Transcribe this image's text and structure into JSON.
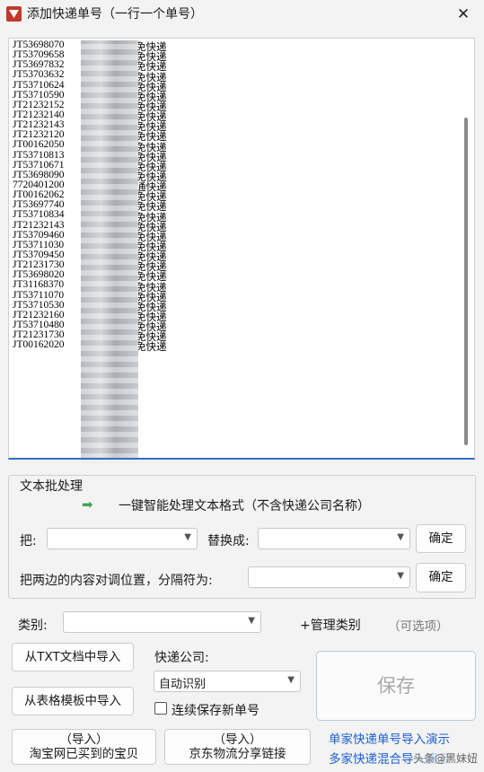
{
  "window": {
    "title": "添加快递单号（一行一个单号）",
    "close_symbol": "✕"
  },
  "textarea": {
    "lines": [
      {
        "id": "JT53698070",
        "svc": "免快递"
      },
      {
        "id": "JT53709658",
        "svc": "免快递"
      },
      {
        "id": "JT53697832",
        "svc": "免快递"
      },
      {
        "id": "JT53703632",
        "svc": "免快递"
      },
      {
        "id": "JT53710624",
        "svc": "免快递"
      },
      {
        "id": "JT53710590",
        "svc": "免快递"
      },
      {
        "id": "JT21232152",
        "svc": "免快递"
      },
      {
        "id": "JT21232140",
        "svc": "免快递"
      },
      {
        "id": "JT21232143",
        "svc": "免快递"
      },
      {
        "id": "JT21232120",
        "svc": "免快递"
      },
      {
        "id": "JT00162050",
        "svc": "免快递"
      },
      {
        "id": "JT53710813",
        "svc": "免快递"
      },
      {
        "id": "JT53710671",
        "svc": "免快递"
      },
      {
        "id": "JT53698090",
        "svc": "免快递"
      },
      {
        "id": "7720401200",
        "svc": "通快递"
      },
      {
        "id": "JT00162062",
        "svc": "免快递"
      },
      {
        "id": "JT53697740",
        "svc": "免快递"
      },
      {
        "id": "JT53710834",
        "svc": "免快递"
      },
      {
        "id": "JT21232143",
        "svc": "免快递"
      },
      {
        "id": "JT53709460",
        "svc": "免快递"
      },
      {
        "id": "JT53711030",
        "svc": "免快递"
      },
      {
        "id": "JT53709450",
        "svc": "免快递"
      },
      {
        "id": "JT21231730",
        "svc": "免快递"
      },
      {
        "id": "JT53698020",
        "svc": "免快递"
      },
      {
        "id": "JT31168370",
        "svc": "免快递"
      },
      {
        "id": "JT53711070",
        "svc": "免快递"
      },
      {
        "id": "JT53710530",
        "svc": "免快递"
      },
      {
        "id": "JT21232160",
        "svc": "免快递"
      },
      {
        "id": "JT53710480",
        "svc": "免快递"
      },
      {
        "id": "JT21231730",
        "svc": "免快递"
      },
      {
        "id": "JT00162020",
        "svc": "免快递"
      }
    ]
  },
  "batch": {
    "group_label": "文本批处理",
    "smart_process": "一键智能处理文本格式（不含快递公司名称）",
    "replace_label": "把:",
    "replace_with_label": "替换成:",
    "replace_from": "",
    "replace_to": "",
    "confirm_label": "确定",
    "swap_label": "把两边的内容对调位置，分隔符为:",
    "separator": "",
    "confirm2_label": "确定"
  },
  "category": {
    "label": "类别:",
    "value": "",
    "manage_label": "+管理类别",
    "optional_label": "（可选项）"
  },
  "import": {
    "txt_label": "从TXT文档中导入",
    "excel_label": "从表格模板中导入",
    "taobao_line1": "（导入）",
    "taobao_line2": "淘宝网已买到的宝贝",
    "jd_line1": "（导入）",
    "jd_line2": "京东物流分享链接"
  },
  "courier": {
    "label": "快递公司:",
    "value": "自动识别",
    "continuous_save_label": "连续保存新单号",
    "continuous_checked": false
  },
  "save": {
    "label": "保存"
  },
  "links": {
    "single_demo": "单家快递单号导入演示",
    "multi_demo": "多家快递混合导入演示"
  },
  "watermark": "头条@黑妹妞"
}
